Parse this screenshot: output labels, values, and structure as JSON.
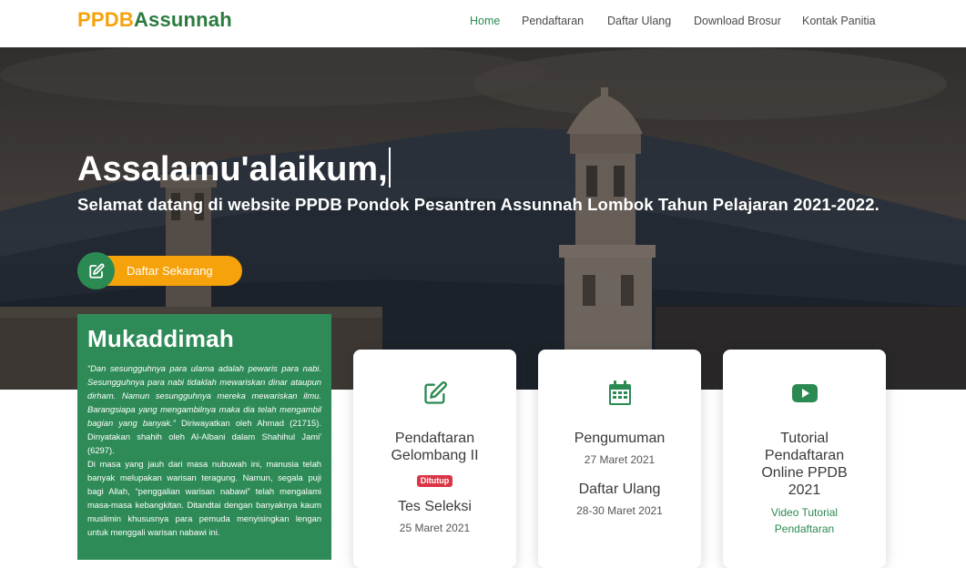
{
  "brand": {
    "part1": "PPDB",
    "part2": "Assunnah"
  },
  "nav": {
    "items": [
      {
        "label": "Home",
        "active": true
      },
      {
        "label": "Pendaftaran"
      },
      {
        "label": "Daftar Ulang"
      },
      {
        "label": "Download Brosur"
      },
      {
        "label": "Kontak Panitia"
      }
    ]
  },
  "hero": {
    "greeting": "Assalamu'alaikum,",
    "subtitle": "Selamat datang di website PPDB Pondok Pesantren Assunnah Lombok Tahun Pelajaran 2021-2022.",
    "cta_label": "Daftar Sekarang"
  },
  "mukaddimah": {
    "title": "Mukaddimah",
    "quote": "“Dan sesungguhnya para ulama adalah pewaris para nabi. Sesungguhnya para nabi tidaklah mewariskan dinar ataupun dirham. Namun sesungguhnya mereka mewariskan ilmu. Barangsiapa yang mengambilnya maka dia telah mengambil bagian yang banyak.”",
    "source": "Diriwayatkan oleh Ahmad (21715). Dinyatakan shahih oleh Al-Albani dalam Shahihul Jami' (6297).",
    "body": "Di masa yang jauh dari masa nubuwah ini, manusia telah banyak melupakan warisan teragung. Namun, segala puji bagi Allah, “penggalian warisan nabawi” telah mengalami masa-masa kebangkitan. Ditandtai dengan banyaknya kaum muslimin khususnya para pemuda menyisingkan lengan untuk menggali warisan nabawi ini."
  },
  "cards": {
    "c1": {
      "icon": "edit-icon",
      "title": "Pendaftaran Gelombang II",
      "badge": "Ditutup",
      "title2": "Tes Seleksi",
      "date2": "25 Maret 2021"
    },
    "c2": {
      "icon": "calendar-icon",
      "title": "Pengumuman",
      "date": "27 Maret 2021",
      "title2": "Daftar Ulang",
      "date2": "28-30 Maret 2021"
    },
    "c3": {
      "icon": "youtube-icon",
      "title": "Tutorial Pendaftaran Online PPDB 2021",
      "link": "Video Tutorial Pendaftaran"
    }
  },
  "colors": {
    "brand_orange": "#f5a20b",
    "brand_green": "#2b8a52",
    "muk_green": "#2e8b57",
    "badge_red": "#dc3545"
  }
}
